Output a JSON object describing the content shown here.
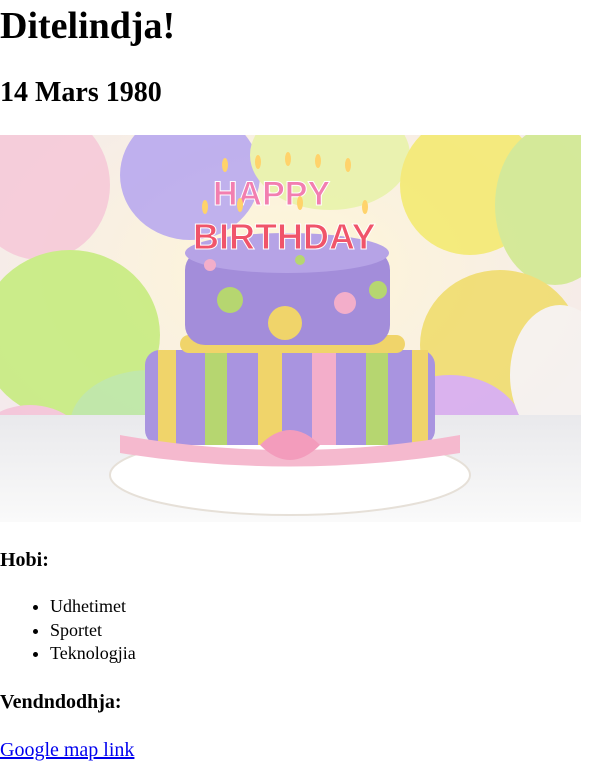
{
  "page": {
    "title": "Ditelindja!",
    "date": "14 Mars 1980"
  },
  "hero_image": {
    "alt": "Happy Birthday cake",
    "cake_text_line1": "HAPPY",
    "cake_text_line2": "BIRTHDAY"
  },
  "hobbies": {
    "heading": "Hobi:",
    "items": [
      "Udhetimet",
      "Sportet",
      "Teknologjia"
    ]
  },
  "location": {
    "heading": "Vendndodhja:",
    "link_text": "Google map link"
  }
}
